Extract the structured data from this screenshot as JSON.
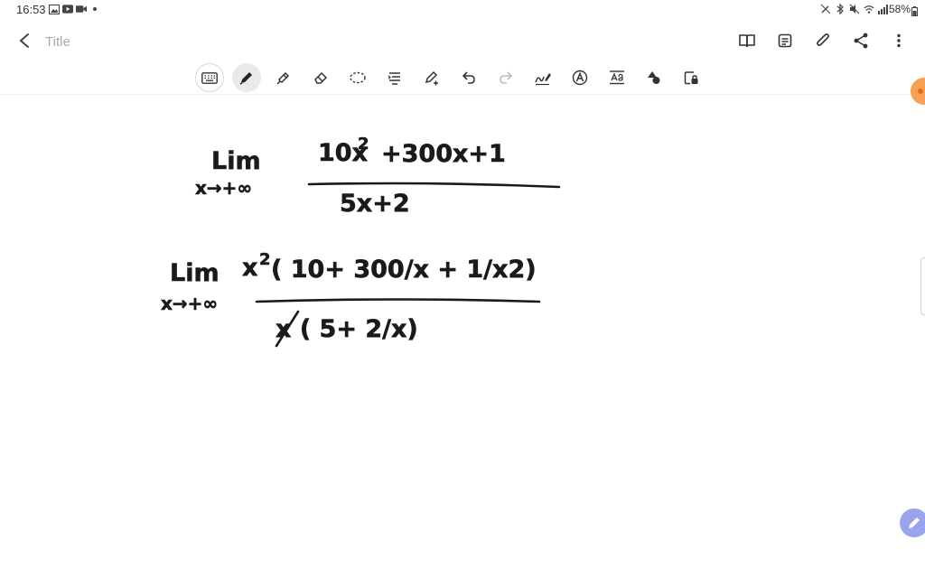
{
  "status_bar": {
    "time": "16:53",
    "left_icons": [
      "image-icon",
      "youtube-icon",
      "video-icon",
      "dot-icon"
    ],
    "right_icons": [
      "pen-off-icon",
      "bluetooth-icon",
      "mute-icon",
      "wifi-icon",
      "signal-icon"
    ],
    "battery_text": "58%"
  },
  "app_bar": {
    "title_placeholder": "Title",
    "title_value": "",
    "actions": [
      "book-icon",
      "note-icon",
      "attach-icon",
      "share-icon",
      "more-icon"
    ]
  },
  "toolbar": {
    "tools": [
      "keyboard",
      "pen",
      "highlighter",
      "eraser",
      "lasso",
      "text-align",
      "pen-settings",
      "undo",
      "redo",
      "handwriting-to-text",
      "text-style",
      "text-box",
      "shapes",
      "lock-object"
    ],
    "active_tool": "pen"
  },
  "note": {
    "expr1": {
      "lim": "Lim",
      "sub": "x→+∞",
      "numerator": "10x",
      "numerator_exp": "2",
      "numerator_rest": "+300x+1",
      "denominator": "5x+2"
    },
    "expr2": {
      "lim": "Lim",
      "sub": "x→+∞",
      "numerator_pre": "x",
      "numerator_exp": "2",
      "numerator_rest": "( 10+ 300/x + 1/x2)",
      "denominator": "x ( 5+ 2/x)"
    }
  },
  "colors": {
    "ink": "#1a1a1a",
    "float_button": "#f8a055",
    "pen_fab": "#9aa4ee"
  }
}
